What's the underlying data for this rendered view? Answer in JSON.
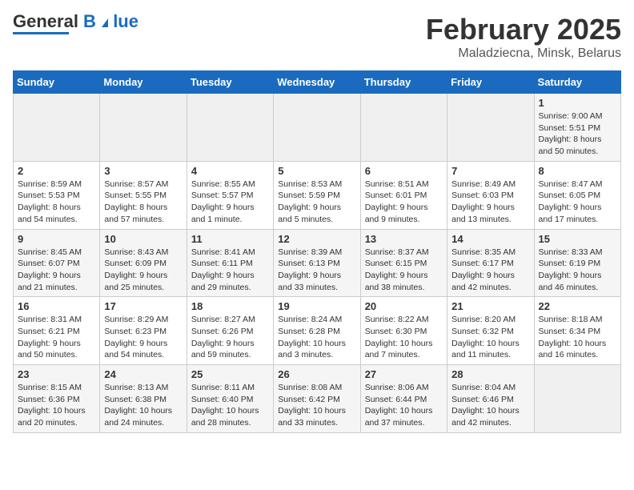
{
  "header": {
    "logo_general": "General",
    "logo_blue": "Blue",
    "month_title": "February 2025",
    "location": "Maladziecna, Minsk, Belarus"
  },
  "calendar": {
    "days_of_week": [
      "Sunday",
      "Monday",
      "Tuesday",
      "Wednesday",
      "Thursday",
      "Friday",
      "Saturday"
    ],
    "weeks": [
      [
        {
          "day": "",
          "info": ""
        },
        {
          "day": "",
          "info": ""
        },
        {
          "day": "",
          "info": ""
        },
        {
          "day": "",
          "info": ""
        },
        {
          "day": "",
          "info": ""
        },
        {
          "day": "",
          "info": ""
        },
        {
          "day": "1",
          "info": "Sunrise: 9:00 AM\nSunset: 5:51 PM\nDaylight: 8 hours and 50 minutes."
        }
      ],
      [
        {
          "day": "2",
          "info": "Sunrise: 8:59 AM\nSunset: 5:53 PM\nDaylight: 8 hours and 54 minutes."
        },
        {
          "day": "3",
          "info": "Sunrise: 8:57 AM\nSunset: 5:55 PM\nDaylight: 8 hours and 57 minutes."
        },
        {
          "day": "4",
          "info": "Sunrise: 8:55 AM\nSunset: 5:57 PM\nDaylight: 9 hours and 1 minute."
        },
        {
          "day": "5",
          "info": "Sunrise: 8:53 AM\nSunset: 5:59 PM\nDaylight: 9 hours and 5 minutes."
        },
        {
          "day": "6",
          "info": "Sunrise: 8:51 AM\nSunset: 6:01 PM\nDaylight: 9 hours and 9 minutes."
        },
        {
          "day": "7",
          "info": "Sunrise: 8:49 AM\nSunset: 6:03 PM\nDaylight: 9 hours and 13 minutes."
        },
        {
          "day": "8",
          "info": "Sunrise: 8:47 AM\nSunset: 6:05 PM\nDaylight: 9 hours and 17 minutes."
        }
      ],
      [
        {
          "day": "9",
          "info": "Sunrise: 8:45 AM\nSunset: 6:07 PM\nDaylight: 9 hours and 21 minutes."
        },
        {
          "day": "10",
          "info": "Sunrise: 8:43 AM\nSunset: 6:09 PM\nDaylight: 9 hours and 25 minutes."
        },
        {
          "day": "11",
          "info": "Sunrise: 8:41 AM\nSunset: 6:11 PM\nDaylight: 9 hours and 29 minutes."
        },
        {
          "day": "12",
          "info": "Sunrise: 8:39 AM\nSunset: 6:13 PM\nDaylight: 9 hours and 33 minutes."
        },
        {
          "day": "13",
          "info": "Sunrise: 8:37 AM\nSunset: 6:15 PM\nDaylight: 9 hours and 38 minutes."
        },
        {
          "day": "14",
          "info": "Sunrise: 8:35 AM\nSunset: 6:17 PM\nDaylight: 9 hours and 42 minutes."
        },
        {
          "day": "15",
          "info": "Sunrise: 8:33 AM\nSunset: 6:19 PM\nDaylight: 9 hours and 46 minutes."
        }
      ],
      [
        {
          "day": "16",
          "info": "Sunrise: 8:31 AM\nSunset: 6:21 PM\nDaylight: 9 hours and 50 minutes."
        },
        {
          "day": "17",
          "info": "Sunrise: 8:29 AM\nSunset: 6:23 PM\nDaylight: 9 hours and 54 minutes."
        },
        {
          "day": "18",
          "info": "Sunrise: 8:27 AM\nSunset: 6:26 PM\nDaylight: 9 hours and 59 minutes."
        },
        {
          "day": "19",
          "info": "Sunrise: 8:24 AM\nSunset: 6:28 PM\nDaylight: 10 hours and 3 minutes."
        },
        {
          "day": "20",
          "info": "Sunrise: 8:22 AM\nSunset: 6:30 PM\nDaylight: 10 hours and 7 minutes."
        },
        {
          "day": "21",
          "info": "Sunrise: 8:20 AM\nSunset: 6:32 PM\nDaylight: 10 hours and 11 minutes."
        },
        {
          "day": "22",
          "info": "Sunrise: 8:18 AM\nSunset: 6:34 PM\nDaylight: 10 hours and 16 minutes."
        }
      ],
      [
        {
          "day": "23",
          "info": "Sunrise: 8:15 AM\nSunset: 6:36 PM\nDaylight: 10 hours and 20 minutes."
        },
        {
          "day": "24",
          "info": "Sunrise: 8:13 AM\nSunset: 6:38 PM\nDaylight: 10 hours and 24 minutes."
        },
        {
          "day": "25",
          "info": "Sunrise: 8:11 AM\nSunset: 6:40 PM\nDaylight: 10 hours and 28 minutes."
        },
        {
          "day": "26",
          "info": "Sunrise: 8:08 AM\nSunset: 6:42 PM\nDaylight: 10 hours and 33 minutes."
        },
        {
          "day": "27",
          "info": "Sunrise: 8:06 AM\nSunset: 6:44 PM\nDaylight: 10 hours and 37 minutes."
        },
        {
          "day": "28",
          "info": "Sunrise: 8:04 AM\nSunset: 6:46 PM\nDaylight: 10 hours and 42 minutes."
        },
        {
          "day": "",
          "info": ""
        }
      ]
    ]
  }
}
